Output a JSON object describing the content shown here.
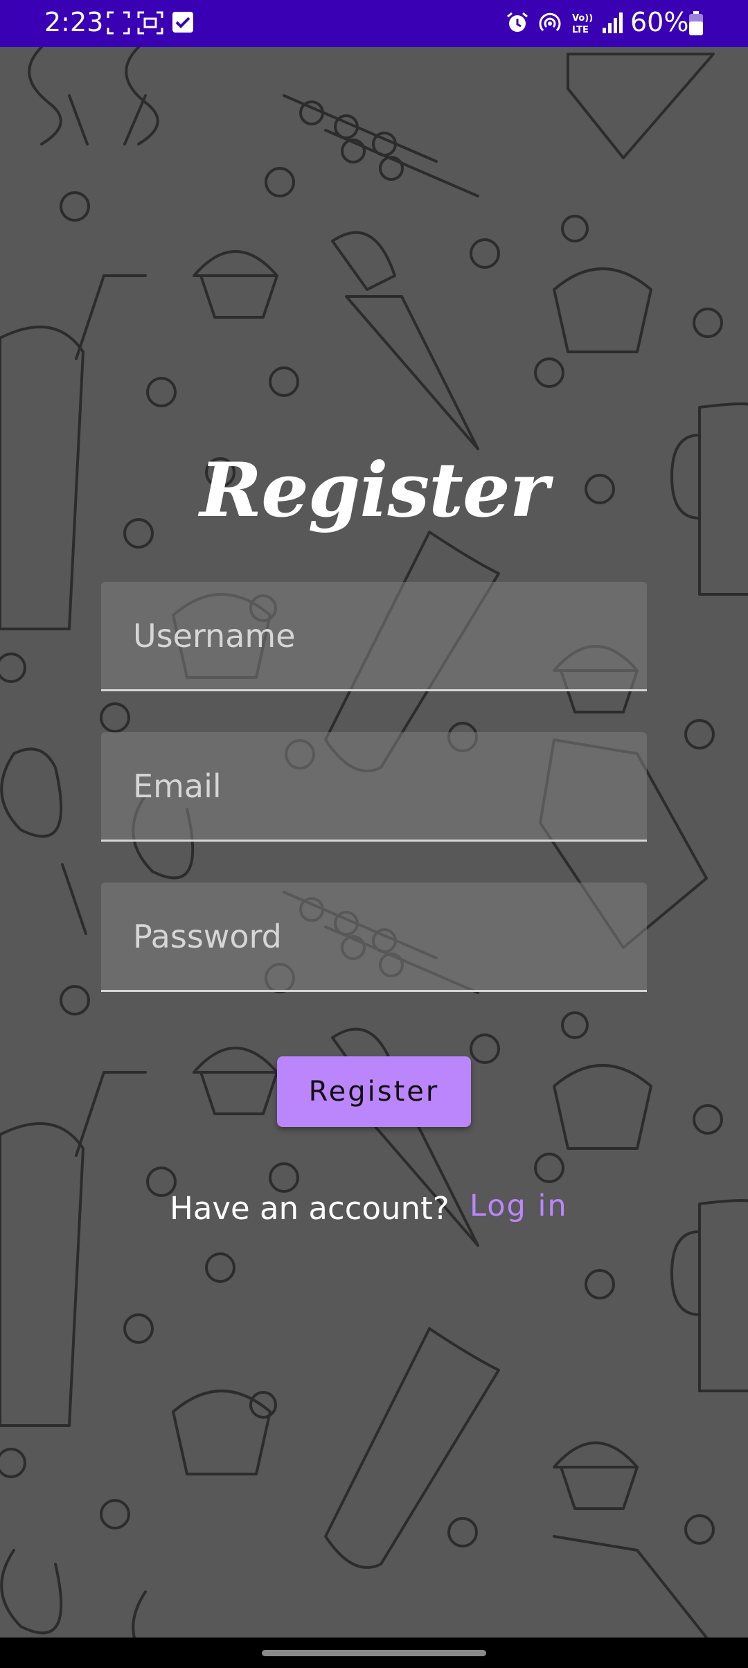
{
  "status_bar": {
    "time": "2:23",
    "battery": "60%",
    "left_icons": [
      "screenshot-corners-icon",
      "screen-capture-icon",
      "checkbox-notification-icon"
    ],
    "right_icons": [
      "alarm-icon",
      "hotspot-icon",
      "volte-icon",
      "signal-icon",
      "battery-icon"
    ],
    "volte_label": "VoLTE"
  },
  "form": {
    "title": "Register",
    "username_placeholder": "Username",
    "email_placeholder": "Email",
    "password_placeholder": "Password",
    "register_button": "Register",
    "have_account_text": "Have an account?",
    "login_link": "Log in"
  },
  "colors": {
    "status_bar": "#3a00b3",
    "background": "#585858",
    "accent": "#bb86fc"
  }
}
